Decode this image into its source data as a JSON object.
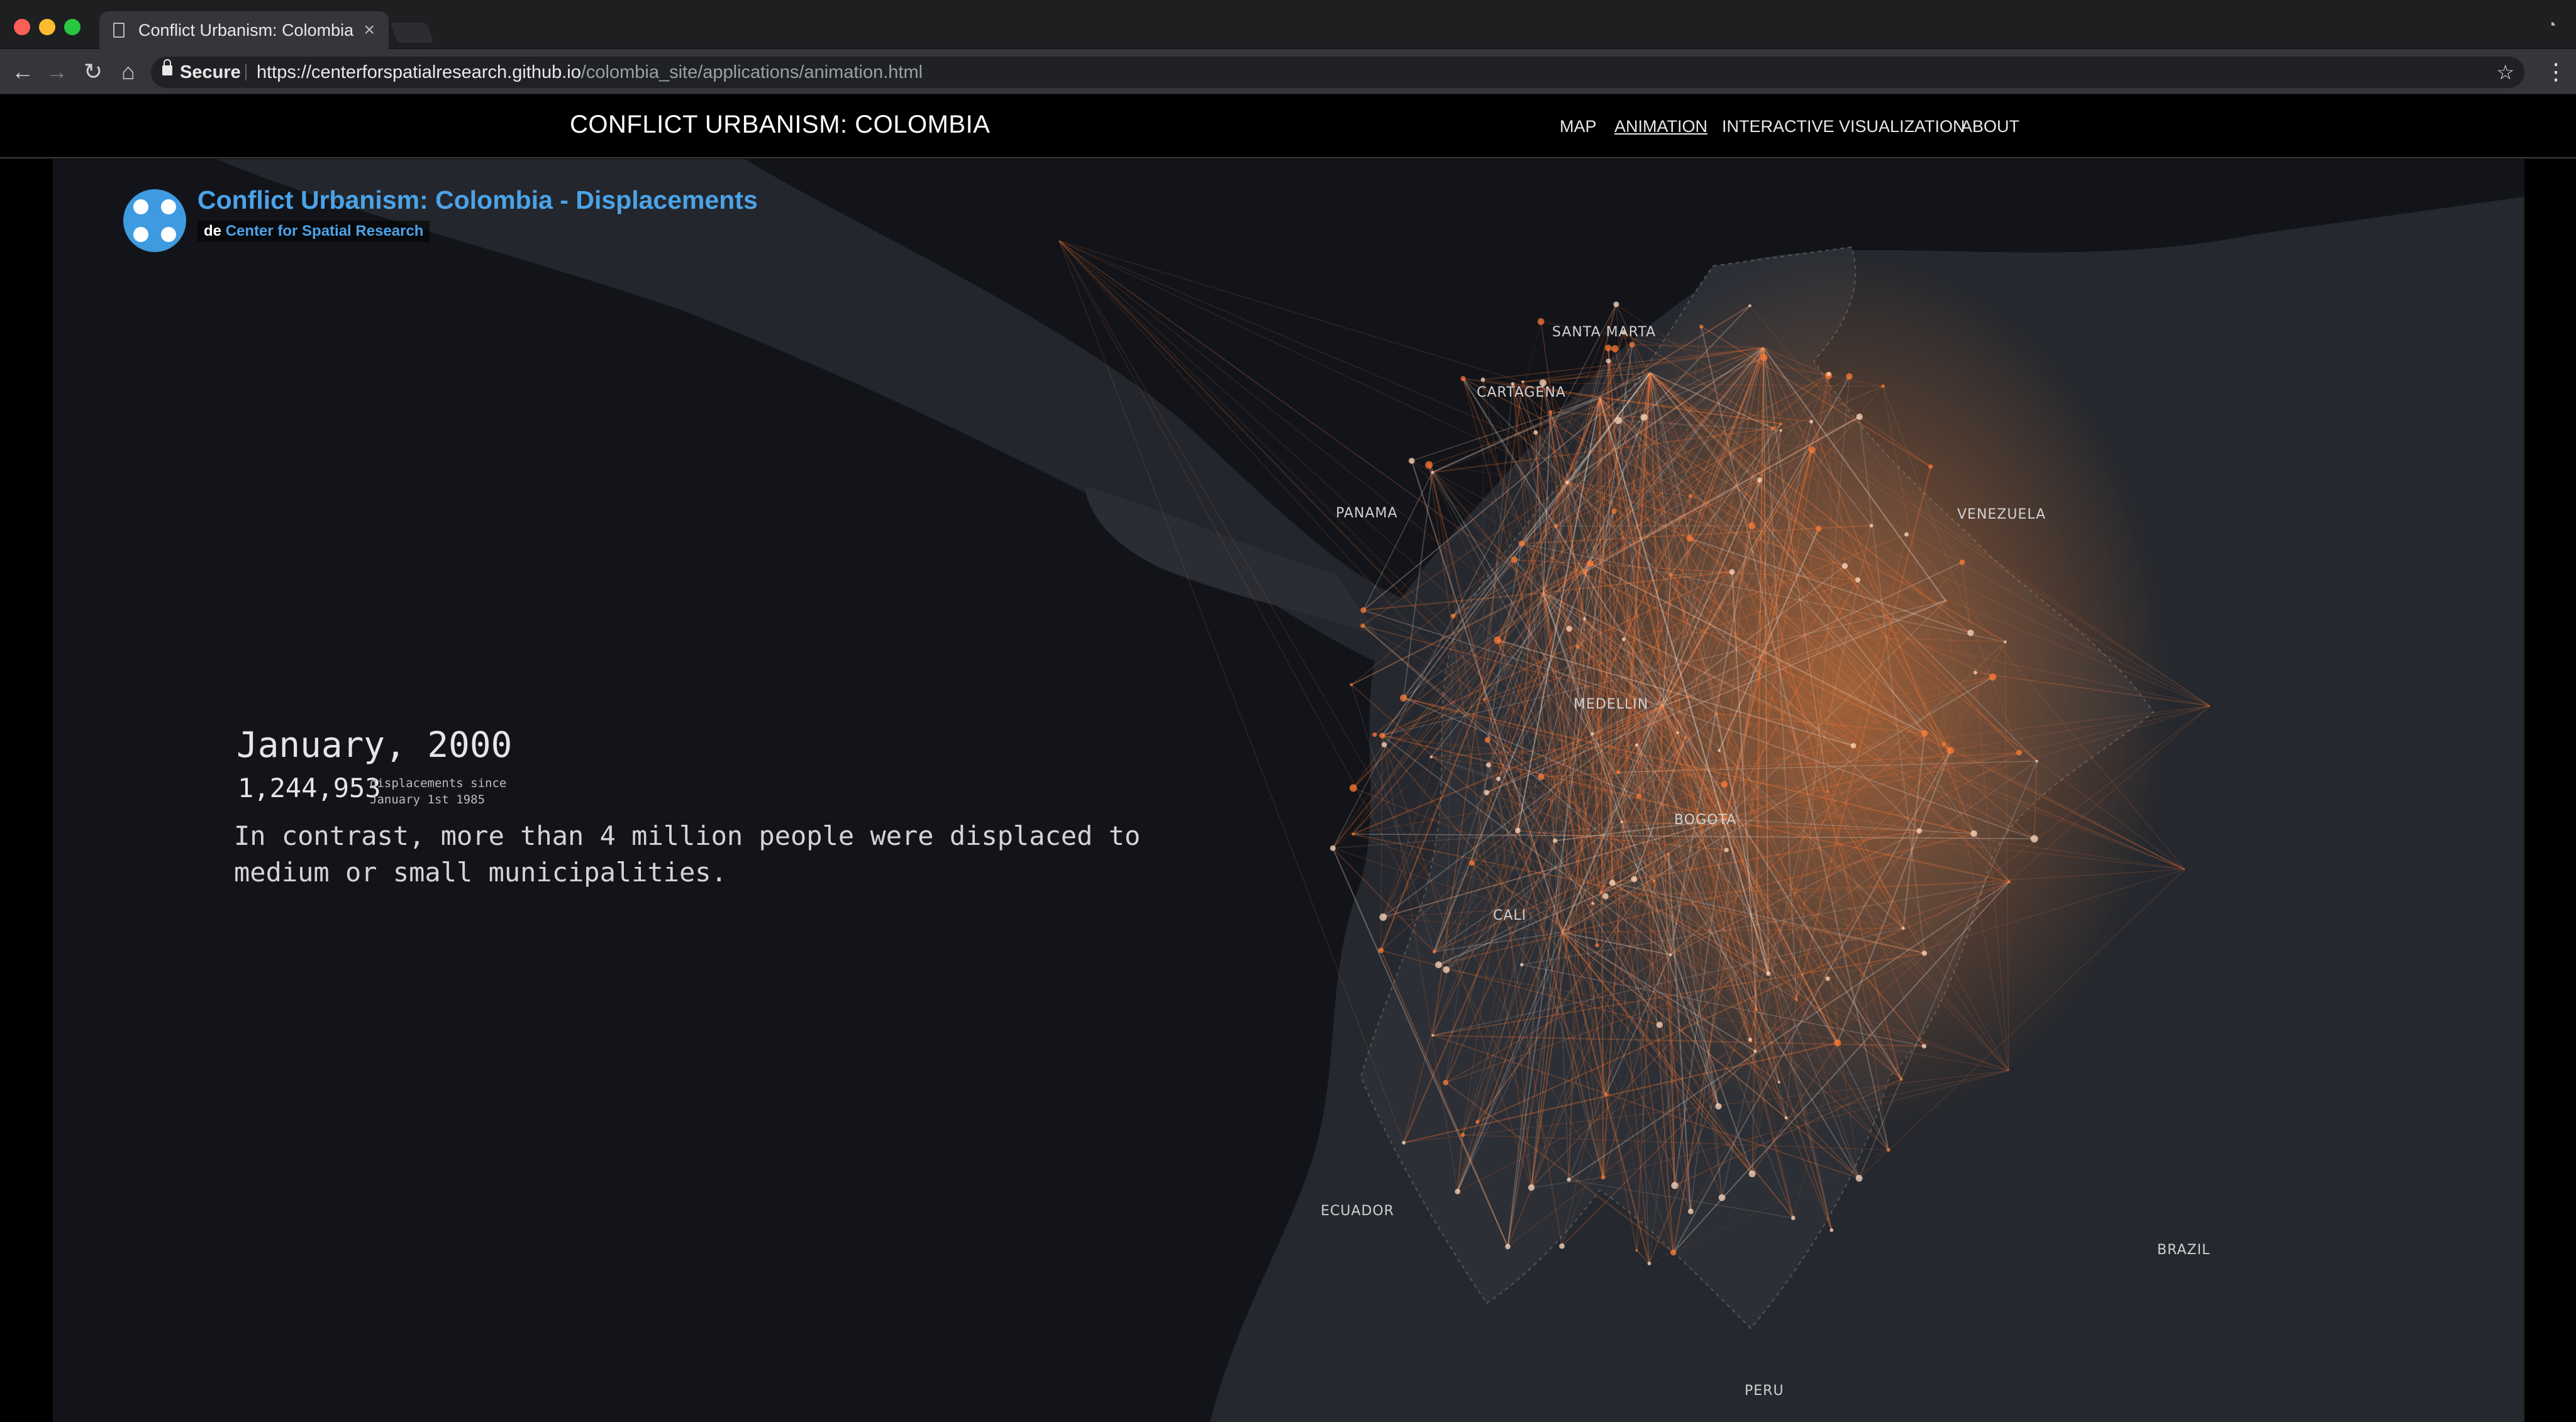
{
  "browser": {
    "tab_title": "Conflict Urbanism: Colombia",
    "tab_close": "×",
    "secure_label": "Secure",
    "url_host": "https://centerforspatialresearch.github.io",
    "url_path": "/colombia_site/applications/animation.html"
  },
  "site": {
    "title": "CONFLICT URBANISM: COLOMBIA",
    "nav": {
      "map": "MAP",
      "animation": "ANIMATION",
      "interactive": "INTERACTIVE VISUALIZATION",
      "about": "ABOUT"
    },
    "active_nav": "animation"
  },
  "embed": {
    "title": "Conflict Urbanism: Colombia - Displacements",
    "by": "de",
    "credit": "Center for Spatial Research",
    "logo_color": "#3f9be0",
    "title_color": "#4ba3e8"
  },
  "overlay": {
    "date": "January, 2000",
    "count": "1,244,953",
    "count_label": "displacements since January 1st 1985",
    "caption": "In contrast, more than 4 million people were displaced to medium or small municipalities."
  },
  "map": {
    "labels": {
      "santa_marta": "SANTA MARTA",
      "cartagena": "CARTAGENA",
      "panama": "PANAMA",
      "venezuela": "VENEZUELA",
      "medellin": "MEDELLIN",
      "bogota": "BOGOTA",
      "cali": "CALI",
      "ecuador": "ECUADOR",
      "brazil": "BRAZIL",
      "peru": "PERU"
    },
    "flow_color": "#ff7a35"
  }
}
